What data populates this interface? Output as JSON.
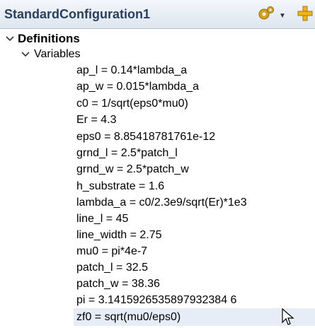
{
  "panel": {
    "title": "StandardConfiguration1"
  },
  "toolbar": {
    "gear_icon": "gear-icon",
    "dropdown_icon": "chevron-down-icon",
    "add_icon": "add-icon"
  },
  "tree": {
    "definitions_label": "Definitions",
    "variables_label": "Variables",
    "variables": [
      "ap_l = 0.14*lambda_a",
      "ap_w = 0.015*lambda_a",
      "c0 = 1/sqrt(eps0*mu0)",
      "Er = 4.3",
      "eps0 = 8.85418781761e-12",
      "grnd_l = 2.5*patch_l",
      "grnd_w = 2.5*patch_w",
      "h_substrate = 1.6",
      "lambda_a = c0/2.3e9/sqrt(Er)*1e3",
      "line_l = 45",
      "line_width = 2.75",
      "mu0 = pi*4e-7",
      "patch_l = 32.5",
      "patch_w = 38.36",
      "pi = 3.1415926535897932384 6",
      "zf0 = sqrt(mu0/eps0)"
    ],
    "selected_variable": "zf0 = sqrt(mu0/eps0)"
  },
  "colors": {
    "header_text": "#2a3f5a",
    "selection": "#e7edf6"
  }
}
